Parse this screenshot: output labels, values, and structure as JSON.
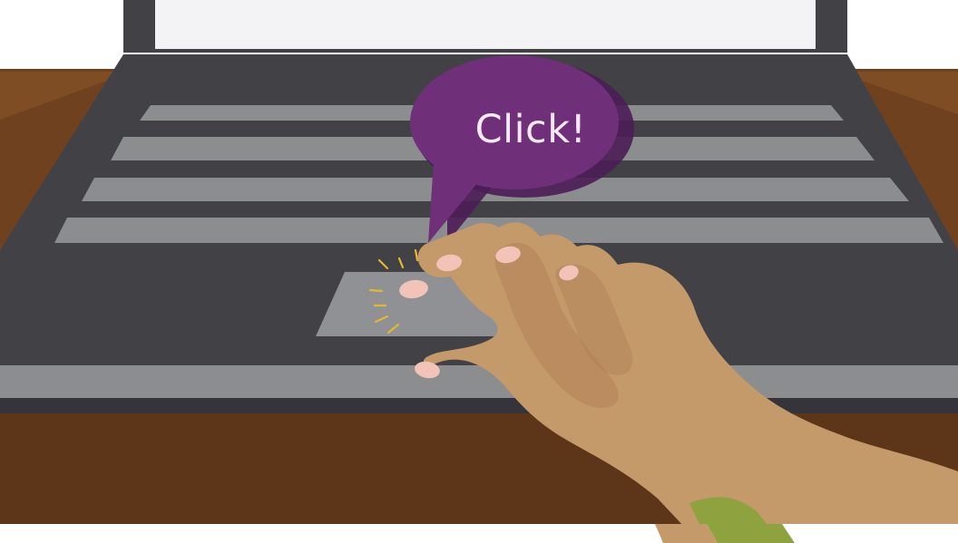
{
  "scene": {
    "bubble_text": "Click!"
  },
  "colors": {
    "background": "#ffffff",
    "desk_wood": "#70411f",
    "desk_wood_dark": "#5d3518",
    "laptop_body": "#424246",
    "laptop_body_dark": "#2f2f33",
    "keys": "#8b8d8f",
    "touchpad": "#8f9194",
    "speech_bubble": "#6f2f79",
    "speech_bubble_shadow": "#4b1d57",
    "skin": "#c59a6b",
    "skin_shadow": "#ad7d52",
    "nails": "#f2c3b8",
    "sleeve": "#8ea23f",
    "click_lines": "#e4b72f"
  },
  "icons": {
    "speech_bubble": "speech-bubble-icon",
    "hand": "hand-icon",
    "click_spark": "click-spark-icon"
  }
}
